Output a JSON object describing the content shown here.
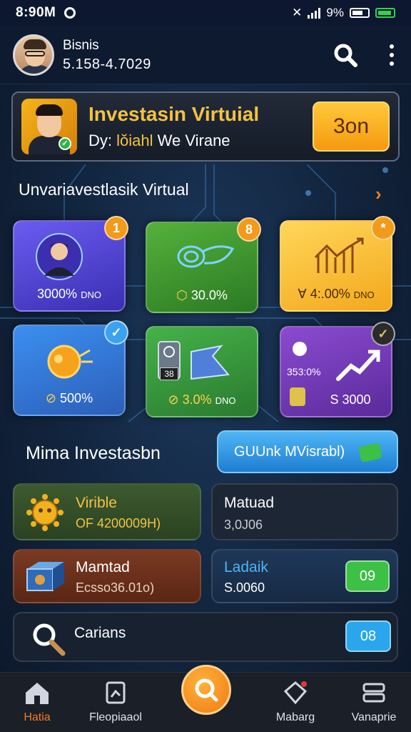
{
  "status_bar": {
    "time": "8:90M",
    "battery_text": "9%"
  },
  "header": {
    "name": "Bisnis",
    "user_id": "5.158-4.7029"
  },
  "banner": {
    "title": "Investasin Virtuial",
    "sub_prefix": "Dy:",
    "sub_highlight": "lŏiahl",
    "sub_suffix": "We Virane",
    "button_label": "3on"
  },
  "section1": {
    "title": "Unvariavestlasik Virtual"
  },
  "cards": [
    {
      "value": "3000%",
      "suffix": "DNO",
      "badge": "1"
    },
    {
      "value": "30.0%",
      "suffix": "",
      "badge": "8"
    },
    {
      "value": "4:.00%",
      "suffix": "DNO",
      "badge": "*"
    },
    {
      "value": "500%",
      "suffix": "",
      "badge": "✓"
    },
    {
      "value": "3.0%",
      "suffix": "DNO",
      "badge": "",
      "tag": "38"
    },
    {
      "value": "S 3000",
      "suffix": "",
      "badge": "✓",
      "tag": "353:0%"
    }
  ],
  "section2": {
    "title": "Mima Investasbn",
    "button_label": "GUUnk MVisrabl)"
  },
  "tiles": [
    {
      "line1": "Virible",
      "line2": "OF 4200009H)"
    },
    {
      "line1": "Matuad",
      "line2": "3,0J06"
    },
    {
      "line1": "Mamtad",
      "line2": "Ecsso36.01o)"
    },
    {
      "line1": "Ladaik",
      "line2": "S.0060",
      "pill": "09"
    },
    {
      "line1": "Carians",
      "pill": "08"
    }
  ],
  "nav": [
    {
      "label": "Hatia",
      "active": true
    },
    {
      "label": "Fleopiaaol"
    },
    {
      "label": "Mabarg"
    },
    {
      "label": "Vanaprie"
    }
  ],
  "colors": {
    "accent": "#f3c244",
    "orange": "#f29a1a",
    "active_nav": "#f07f1e"
  }
}
